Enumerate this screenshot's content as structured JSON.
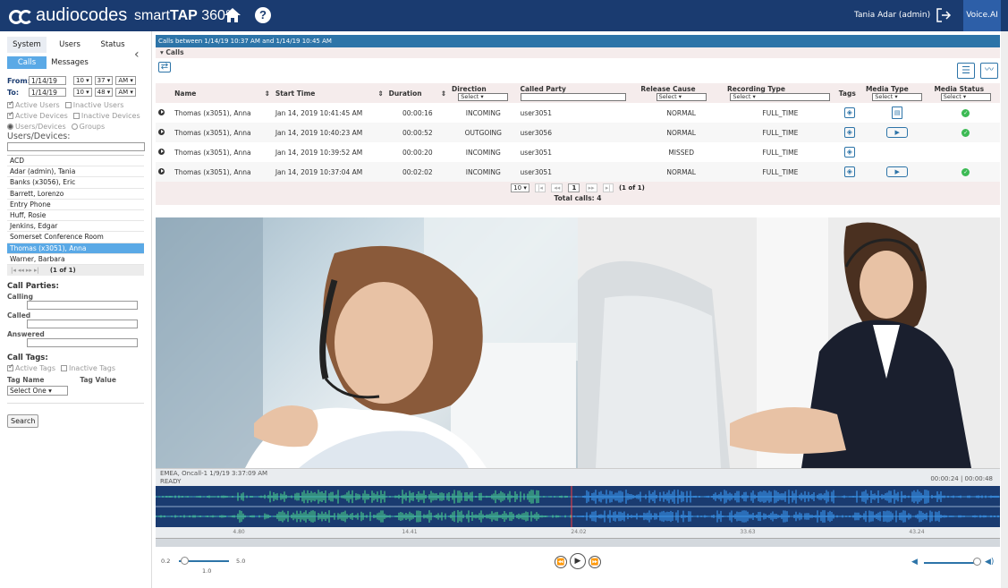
{
  "header": {
    "brand": "audiocodes",
    "product_prefix": "smart",
    "product_bold": "TAP",
    "product_suffix": " 360°",
    "user": "Tania Adar (admin)",
    "voiceai": "Voice.AI"
  },
  "sidebar": {
    "tabs": [
      "System",
      "Users",
      "Status"
    ],
    "subtabs": [
      "Calls",
      "Messages"
    ],
    "from_label": "From:",
    "to_label": "To:",
    "from": {
      "date": "1/14/19",
      "hour": "10 ▾",
      "min": "37 ▾",
      "ampm": "AM ▾"
    },
    "to": {
      "date": "1/14/19",
      "hour": "10 ▾",
      "min": "48 ▾",
      "ampm": "AM ▾"
    },
    "active_users": "Active Users",
    "inactive_users": "Inactive Users",
    "active_devices": "Active Devices",
    "inactive_devices": "Inactive Devices",
    "users_devices_radio": "Users/Devices",
    "groups_radio": "Groups",
    "users_devices_label": "Users/Devices:",
    "list": [
      "ACD",
      "Adar (admin), Tania",
      "Banks (x3056), Eric",
      "Barrett, Lorenzo",
      "Entry Phone",
      "Huff, Rosie",
      "Jenkins, Edgar",
      "Somerset Conference Room",
      "Thomas (x3051), Anna",
      "Warner, Barbara"
    ],
    "list_pager": "(1 of 1)",
    "call_parties": "Call Parties:",
    "calling": "Calling",
    "called": "Called",
    "answered": "Answered",
    "call_tags": "Call Tags:",
    "active_tags": "Active Tags",
    "inactive_tags": "Inactive Tags",
    "tag_name": "Tag Name",
    "tag_value": "Tag Value",
    "tag_select": "Select One",
    "search": "Search"
  },
  "main": {
    "range": "Calls between 1/14/19 10:37 AM and 1/14/19 10:45 AM",
    "calls_title": "▾ Calls",
    "columns": {
      "name": "Name",
      "start": "Start Time",
      "duration": "Duration",
      "direction": "Direction",
      "called": "Called Party",
      "release": "Release Cause",
      "rectype": "Recording Type",
      "tags": "Tags",
      "mtype": "Media Type",
      "mstatus": "Media Status",
      "select": "Select"
    },
    "rows": [
      {
        "name": "Thomas (x3051), Anna",
        "start": "Jan 14, 2019 10:41:45 AM",
        "duration": "00:00:16",
        "direction": "INCOMING",
        "called": "user3051",
        "release": "NORMAL",
        "rectype": "FULL_TIME"
      },
      {
        "name": "Thomas (x3051), Anna",
        "start": "Jan 14, 2019 10:40:23 AM",
        "duration": "00:00:52",
        "direction": "OUTGOING",
        "called": "user3056",
        "release": "NORMAL",
        "rectype": "FULL_TIME"
      },
      {
        "name": "Thomas (x3051), Anna",
        "start": "Jan 14, 2019 10:39:52 AM",
        "duration": "00:00:20",
        "direction": "INCOMING",
        "called": "user3051",
        "release": "MISSED",
        "rectype": "FULL_TIME"
      },
      {
        "name": "Thomas (x3051), Anna",
        "start": "Jan 14, 2019 10:37:04 AM",
        "duration": "00:02:02",
        "direction": "INCOMING",
        "called": "user3051",
        "release": "NORMAL",
        "rectype": "FULL_TIME"
      }
    ],
    "pager": {
      "size": "10 ▾",
      "page": "1",
      "info": "(1 of 1)"
    },
    "total": "Total calls: 4"
  },
  "player": {
    "title": "EMEA, Oncall-1 1/9/19 3:37:09 AM",
    "state": "READY",
    "time": "00:00:24 | 00:00:48",
    "ticks": [
      "4.80",
      "14.41",
      "24.02",
      "33.63",
      "43.24"
    ],
    "speed_min": "0.2",
    "speed_val": "1.0",
    "speed_max": "5.0"
  }
}
